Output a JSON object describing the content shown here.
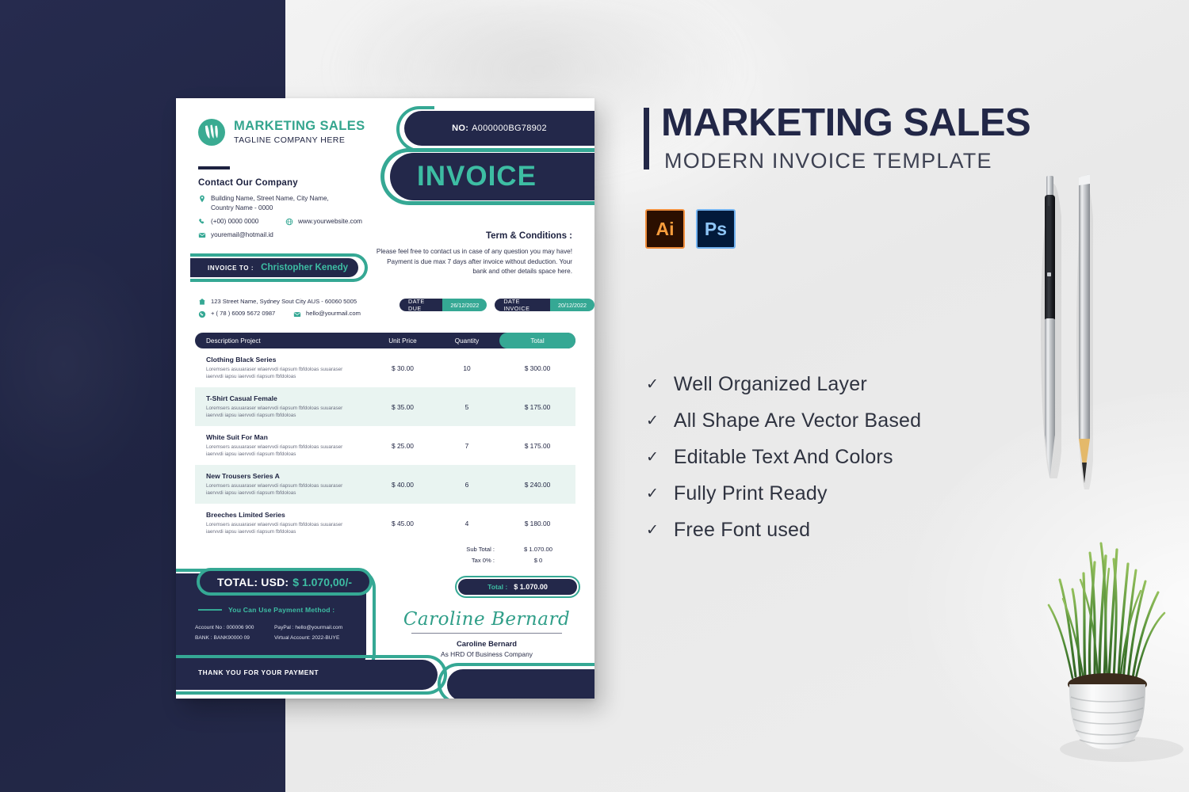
{
  "invoice": {
    "brand": {
      "name": "MARKETING SALES",
      "tagline": "TAGLINE COMPANY HERE",
      "logo_icon": "leaf-logo-icon"
    },
    "contact": {
      "title": "Contact Our Company",
      "address_line1": "Building Name, Street Name, City Name,",
      "address_line2": "Country Name - 0000",
      "phone": "(+00) 0000 0000",
      "website": "www.yourwebsite.com",
      "email": "youremail@hotmail.id"
    },
    "number": {
      "label": "NO:",
      "value": "A000000BG78902"
    },
    "banner_title": "INVOICE",
    "terms": {
      "title": "Term & Conditions :",
      "body": "Please feel free to contact us in case of any question you may have! Payment is due max 7 days after invoice without deduction. Your bank and other details space here."
    },
    "dates": [
      {
        "label": "DATE DUE",
        "value": "26/12/2022"
      },
      {
        "label": "DATE INVOICE",
        "value": "20/12/2022"
      }
    ],
    "invoice_to": {
      "label": "INVOICE TO :",
      "client": "Christopher Kenedy",
      "address": "123 Street Name, Sydney Sout City AUS - 60060 5005",
      "phone": "+ ( 78 ) 6009 5672 0987",
      "email": "hello@yourmail.com"
    },
    "table": {
      "headers": {
        "description": "Description Project",
        "unit_price": "Unit Price",
        "quantity": "Quantity",
        "total": "Total"
      },
      "rows": [
        {
          "name": "Clothing Black Series",
          "desc": "Loremsers asuuaraser wlaervvdi riapsum fbfdoloas suuaraser iaervvdi iapsu iaervvdi riapsum fbfdoloas",
          "unit_price": "$ 30.00",
          "quantity": "10",
          "total": "$ 300.00"
        },
        {
          "name": "T-Shirt Casual Female",
          "desc": "Loremsers asuuaraser wlaervvdi riapsum fbfdoloas suuaraser iaervvdi iapsu iaervvdi riapsum fbfdoloas",
          "unit_price": "$ 35.00",
          "quantity": "5",
          "total": "$ 175.00"
        },
        {
          "name": "White Suit For Man",
          "desc": "Loremsers asuuaraser wlaervvdi riapsum fbfdoloas suuaraser iaervvdi iapsu iaervvdi riapsum fbfdoloas",
          "unit_price": "$ 25.00",
          "quantity": "7",
          "total": "$ 175.00"
        },
        {
          "name": "New Trousers Series A",
          "desc": "Loremsers asuuaraser wlaervvdi riapsum fbfdoloas suuaraser iaervvdi iapsu iaervvdi riapsum fbfdoloas",
          "unit_price": "$ 40.00",
          "quantity": "6",
          "total": "$ 240.00"
        },
        {
          "name": "Breeches Limited Series",
          "desc": "Loremsers asuuaraser wlaervvdi riapsum fbfdoloas suuaraser iaervvdi iapsu iaervvdi riapsum fbfdoloas",
          "unit_price": "$ 45.00",
          "quantity": "4",
          "total": "$ 180.00"
        }
      ]
    },
    "summary": {
      "sub_total_label": "Sub Total :",
      "sub_total_value": "$ 1.070.00",
      "tax_label": "Tax 0% :",
      "tax_value": "$ 0",
      "total_label": "Total :",
      "total_value": "$ 1.070.00"
    },
    "grand_total": {
      "label": "TOTAL: USD:",
      "value": "$ 1.070,00/-"
    },
    "payment": {
      "title": "You Can Use Payment Method :",
      "account_no": "Account No : 000006 900",
      "bank": "BANK : BANK90000 09",
      "paypal": "PayPal : hello@yourmail.com",
      "virtual_account": "Virtual Account: 2022-BUYE"
    },
    "signature": {
      "script": "Caroline Bernard",
      "name": "Caroline Bernard",
      "role": "As HRD Of Business Company"
    },
    "footer": "THANK YOU FOR YOUR PAYMENT"
  },
  "promo": {
    "title": "MARKETING SALES",
    "subtitle": "MODERN INVOICE TEMPLATE",
    "badges": [
      {
        "id": "ai",
        "label": "Ai"
      },
      {
        "id": "ps",
        "label": "Ps"
      }
    ],
    "features": [
      "Well Organized Layer",
      "All Shape Are Vector Based",
      "Editable Text And Colors",
      "Fully Print Ready",
      "Free Font used"
    ],
    "check_glyph": "✓"
  },
  "colors": {
    "navy": "#23284a",
    "teal": "#35a894",
    "teal_bright": "#3dbda3",
    "panel_bg": "#ececec",
    "row_alt": "#e9f4f1"
  },
  "props": {
    "pen": "ballpoint-pen",
    "pencil": "graphite-pencil",
    "plant": "potted-grass-plant"
  }
}
